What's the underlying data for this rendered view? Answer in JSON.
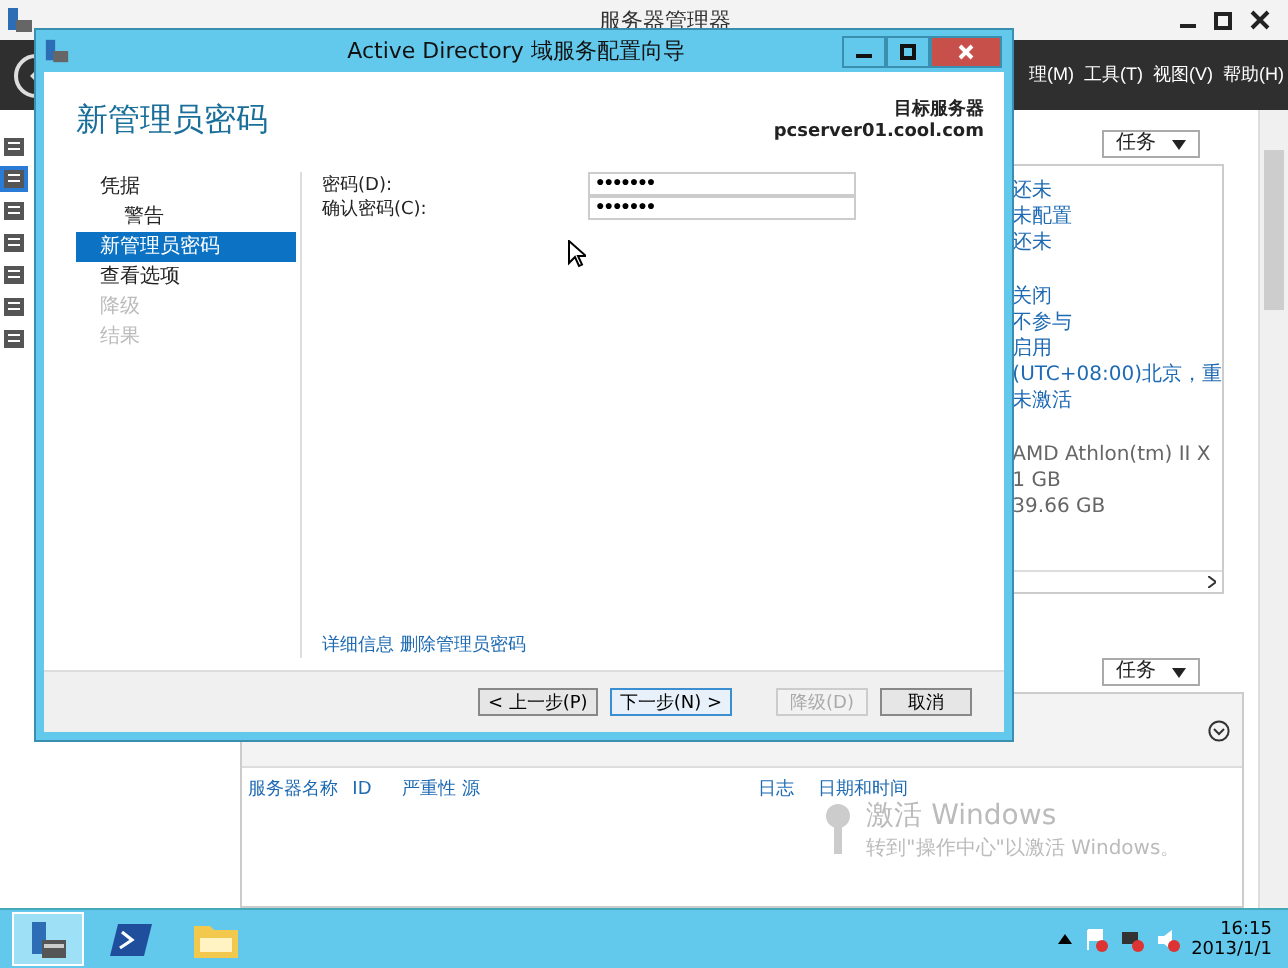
{
  "server_manager": {
    "title": "服务器管理器",
    "menu": [
      "理(M)",
      "工具(T)",
      "视图(V)",
      "帮助(H)"
    ],
    "nav_items": [
      {
        "selected": false
      },
      {
        "selected": true
      },
      {
        "selected": false
      },
      {
        "selected": false
      },
      {
        "selected": false
      },
      {
        "selected": false
      },
      {
        "selected": false
      }
    ],
    "properties_panel": {
      "tasks_button": "任务",
      "groups": [
        {
          "kind": "link",
          "values": [
            "还未",
            "未配置",
            "还未"
          ]
        },
        {
          "kind": "link",
          "values": [
            "关闭",
            "不参与",
            "启用",
            "(UTC+08:00)北京，重",
            "未激活"
          ]
        },
        {
          "kind": "plain",
          "values": [
            "AMD Athlon(tm) II X",
            "1 GB",
            "39.66 GB"
          ]
        }
      ]
    },
    "events_panel": {
      "tasks_button": "任务",
      "columns": [
        "服务器名称",
        "ID",
        "严重性",
        "源",
        "日志",
        "日期和时间"
      ]
    },
    "activation_notice": {
      "title": "激活 Windows",
      "text": "转到\"操作中心\"以激活 Windows。"
    }
  },
  "wizard": {
    "title": "Active Directory 域服务配置向导",
    "heading": "新管理员密码",
    "target_label": "目标服务器",
    "target_server": "pcserver01.cool.com",
    "steps": [
      {
        "label": "凭据",
        "selected": false,
        "disabled": false,
        "children": [
          {
            "label": "警告",
            "selected": false,
            "disabled": false
          }
        ]
      },
      {
        "label": "新管理员密码",
        "selected": true,
        "disabled": false
      },
      {
        "label": "查看选项",
        "selected": false,
        "disabled": false
      },
      {
        "label": "降级",
        "selected": false,
        "disabled": true
      },
      {
        "label": "结果",
        "selected": false,
        "disabled": true
      }
    ],
    "fields": [
      {
        "label": "密码(D):",
        "value": "●●●●●●●"
      },
      {
        "label": "确认密码(C):",
        "value": "●●●●●●●"
      }
    ],
    "link": "详细信息 删除管理员密码",
    "buttons": [
      {
        "label": "< 上一步(P)",
        "disabled": false,
        "focused": false
      },
      {
        "label": "下一步(N) >",
        "disabled": false,
        "focused": true
      },
      {
        "label": "降级(D)",
        "disabled": true,
        "focused": false
      },
      {
        "label": "取消",
        "disabled": false,
        "focused": false
      }
    ]
  },
  "taskbar": {
    "apps": [
      {
        "kind": "server-manager",
        "selected": true
      },
      {
        "kind": "powershell",
        "selected": false
      },
      {
        "kind": "explorer",
        "selected": false
      }
    ],
    "time": "16:15",
    "date": "2013/1/1"
  }
}
